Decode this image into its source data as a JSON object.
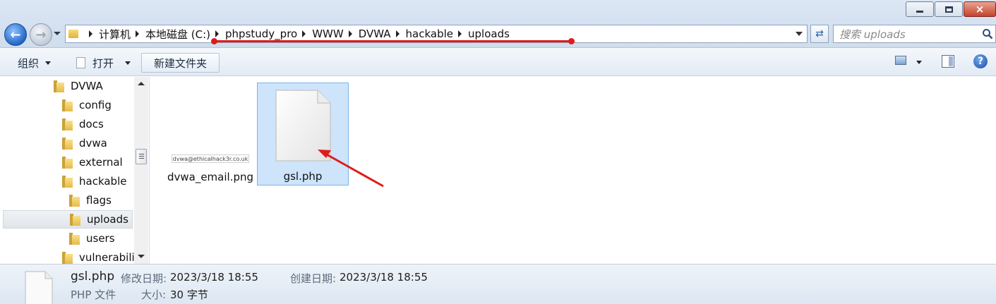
{
  "window": {
    "controls": {
      "minimize": "minimize",
      "maximize": "maximize",
      "close": "×"
    }
  },
  "nav": {
    "back_icon": "back-arrow-icon",
    "forward_icon": "forward-arrow-icon"
  },
  "address_bar": {
    "breadcrumbs": [
      "计算机",
      "本地磁盘 (C:)",
      "phpstudy_pro",
      "WWW",
      "DVWA",
      "hackable",
      "uploads"
    ]
  },
  "search": {
    "placeholder": "搜索 uploads"
  },
  "toolbar": {
    "organize": "组织",
    "open": "打开",
    "new_folder": "新建文件夹"
  },
  "sidebar": {
    "items": [
      {
        "label": "DVWA",
        "level": 0
      },
      {
        "label": "config",
        "level": 1
      },
      {
        "label": "docs",
        "level": 1
      },
      {
        "label": "dvwa",
        "level": 1
      },
      {
        "label": "external",
        "level": 1
      },
      {
        "label": "hackable",
        "level": 1
      },
      {
        "label": "flags",
        "level": 2
      },
      {
        "label": "uploads",
        "level": 2,
        "selected": true
      },
      {
        "label": "users",
        "level": 2
      },
      {
        "label": "vulnerabili",
        "level": 1
      }
    ]
  },
  "files": [
    {
      "name": "dvwa_email.png",
      "thumb_text": "dvwa@ethicalhack3r.co.uk",
      "selected": false
    },
    {
      "name": "gsl.php",
      "selected": true
    }
  ],
  "details": {
    "name": "gsl.php",
    "type": "PHP 文件",
    "modified_label": "修改日期:",
    "modified_value": "2023/3/18 18:55",
    "created_label": "创建日期:",
    "created_value": "2023/3/18 18:55",
    "size_label": "大小:",
    "size_value": "30 字节"
  },
  "colors": {
    "annotation": "#e01b1b",
    "selection": "#cde4fb"
  }
}
